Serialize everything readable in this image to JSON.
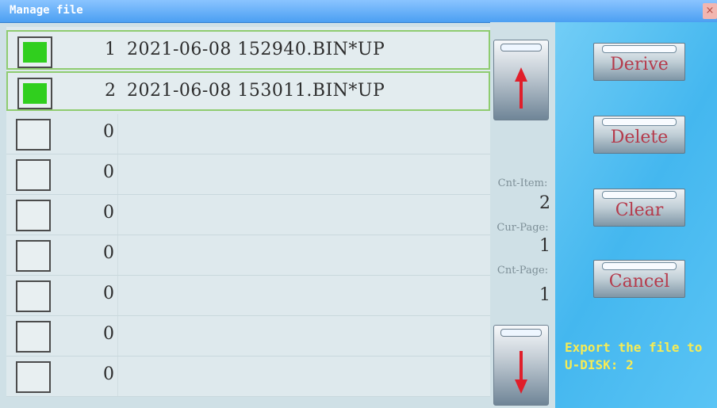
{
  "window": {
    "title": "Manage file",
    "close_label": "×"
  },
  "file_rows": [
    {
      "index": "1",
      "text": "2021-06-08 152940.BIN*UP",
      "selected": true
    },
    {
      "index": "2",
      "text": "2021-06-08 153011.BIN*UP",
      "selected": true
    },
    {
      "index": "0",
      "text": "",
      "selected": false
    },
    {
      "index": "0",
      "text": "",
      "selected": false
    },
    {
      "index": "0",
      "text": "",
      "selected": false
    },
    {
      "index": "0",
      "text": "",
      "selected": false
    },
    {
      "index": "0",
      "text": "",
      "selected": false
    },
    {
      "index": "0",
      "text": "",
      "selected": false
    },
    {
      "index": "0",
      "text": "",
      "selected": false
    }
  ],
  "scroll": {
    "up_icon": "arrow-up-icon",
    "down_icon": "arrow-down-icon",
    "arrow_color": "#e01e2a"
  },
  "stats": {
    "cnt_item_label": "Cnt-Item:",
    "cnt_item_value": "2",
    "cur_page_label": "Cur-Page:",
    "cur_page_value": "1",
    "cnt_page_label": "Cnt-Page:",
    "cnt_page_value": "1"
  },
  "actions": {
    "derive_label": "Derive",
    "delete_label": "Delete",
    "clear_label": "Clear",
    "cancel_label": "Cancel"
  },
  "export_status": "Export the file to U-DISK: 2",
  "colors": {
    "check_fill": "#30cf1e",
    "side_panel": "#44b7ef",
    "status_text": "#f7ec54",
    "button_text": "#b53a4b"
  }
}
